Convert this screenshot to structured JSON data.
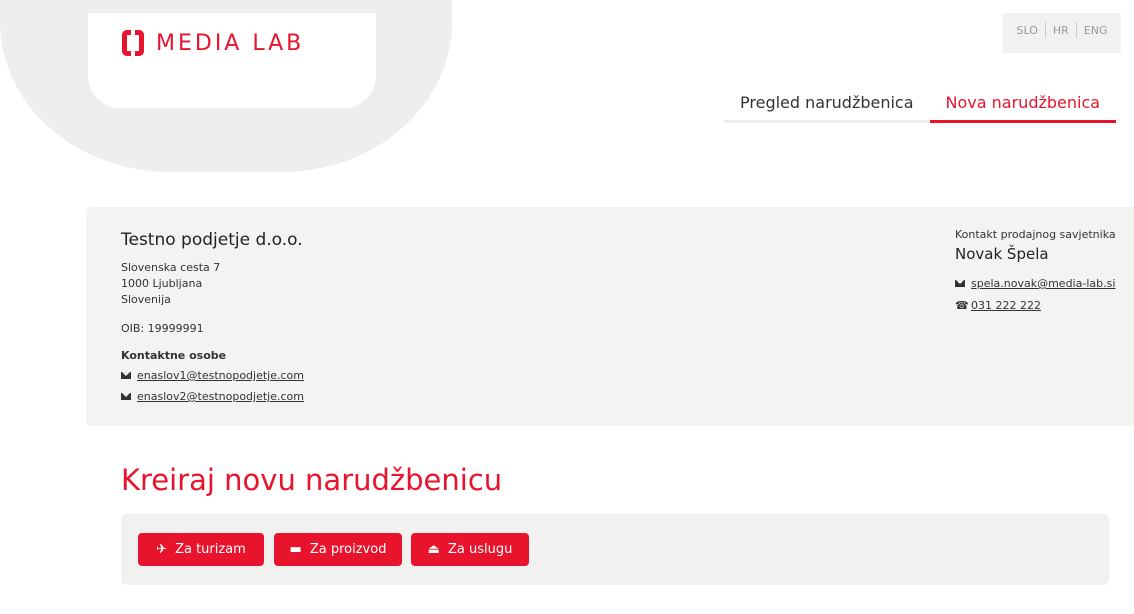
{
  "brand": {
    "name": "MEDIA LAB",
    "accent_color": "#e8142d"
  },
  "languages": [
    "SLO",
    "HR",
    "ENG"
  ],
  "nav": {
    "tabs": [
      {
        "label": "Pregled narudžbenica",
        "active": false
      },
      {
        "label": "Nova narudžbenica",
        "active": true
      }
    ]
  },
  "company": {
    "name": "Testno podjetje d.o.o.",
    "address": [
      "Slovenska cesta 7",
      "1000 Ljubljana",
      "Slovenija"
    ],
    "oib": "OIB: 19999991",
    "contacts_heading": "Kontaktne osobe",
    "emails": [
      "enaslov1@testnopodjetje.com",
      "enaslov2@testnopodjetje.com"
    ]
  },
  "advisor": {
    "heading": "Kontakt prodajnog savjetnika",
    "name": "Novak Špela",
    "email": "spela.novak@media-lab.si",
    "phone": "031 222 222"
  },
  "main": {
    "title": "Kreiraj novu narudžbenicu",
    "buttons": [
      {
        "label": "Za turizam",
        "icon": "plane-icon"
      },
      {
        "label": "Za proizvod",
        "icon": "book-icon"
      },
      {
        "label": "Za uslugu",
        "icon": "eject-icon"
      }
    ]
  }
}
